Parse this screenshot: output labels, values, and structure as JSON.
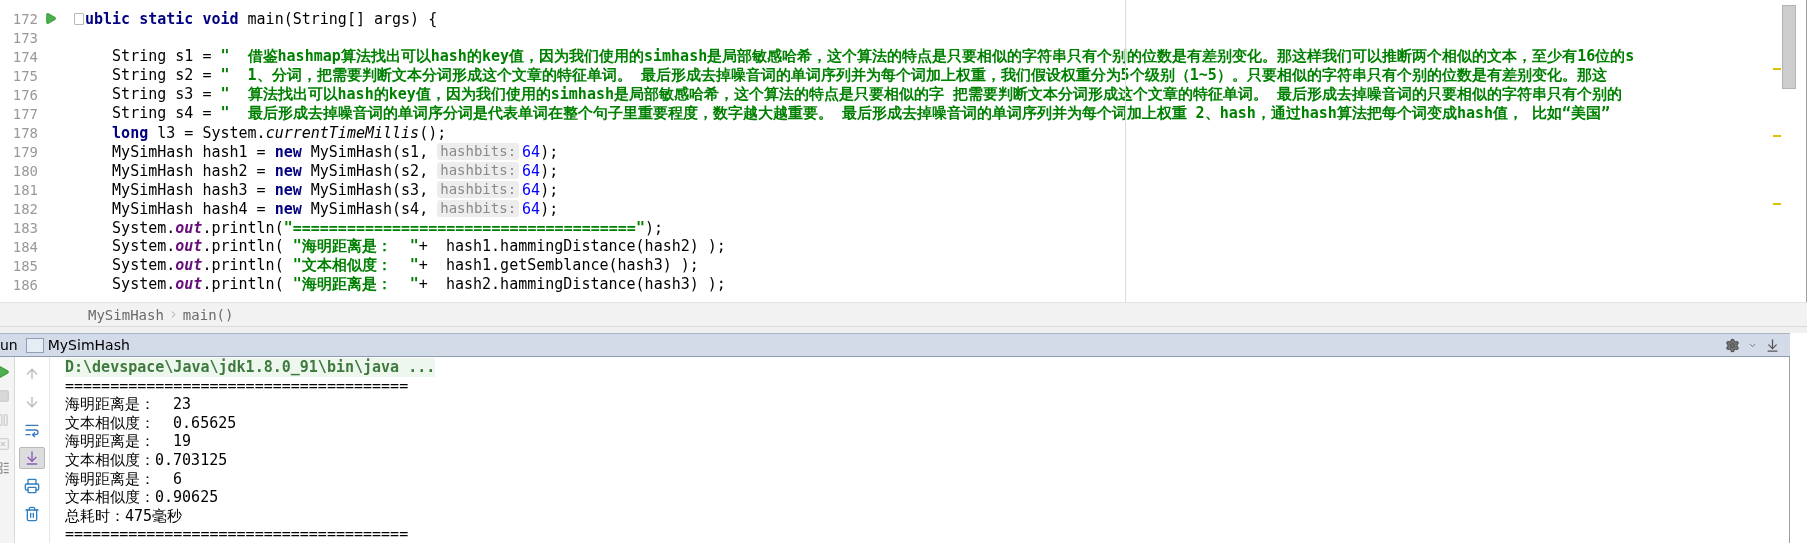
{
  "editor": {
    "lines": [
      {
        "number": "172",
        "run_marker": true,
        "fold_marker": true,
        "current": false,
        "segments": [
          {
            "kind": "keyword",
            "text": "ublic static void"
          },
          {
            "kind": "plain",
            "text": " main(String[] args) {"
          }
        ]
      },
      {
        "number": "173",
        "run_marker": false,
        "fold_marker": false,
        "current": false
      },
      {
        "number": "174",
        "run_marker": false,
        "fold_marker": false,
        "current": false,
        "segments": [
          {
            "kind": "plain",
            "text": "   String s1 = "
          },
          {
            "kind": "string",
            "text": "\"  借鉴hashmap算法找出可以hash的key值，因为我们使用的simhash是局部敏感哈希，这个算法的特点是只要相似的字符串只有个别的位数是有差别变化。那这样我们可以推断两个相似的文本，至少有16位的s"
          }
        ]
      },
      {
        "number": "175",
        "run_marker": false,
        "fold_marker": false,
        "current": false,
        "segments": [
          {
            "kind": "plain",
            "text": "   String s2 = "
          },
          {
            "kind": "string",
            "text": "\"  1、分词，把需要判断文本分词形成这个文章的特征单词。 最后形成去掉噪音词的单词序列并为每个词加上权重，我们假设权重分为5个级别（1~5）。只要相似的字符串只有个别的位数是有差别变化。那这"
          }
        ]
      },
      {
        "number": "176",
        "run_marker": false,
        "fold_marker": false,
        "current": false,
        "segments": [
          {
            "kind": "plain",
            "text": "   String s3 = "
          },
          {
            "kind": "string",
            "text": "\"  算法找出可以hash的key值，因为我们使用的simhash是局部敏感哈希，这个算法的特点是只要相似的字 把需要判断文本分词形成这个文章的特征单词。 最后形成去掉噪音词的只要相似的字符串只有个别的"
          }
        ]
      },
      {
        "number": "177",
        "run_marker": false,
        "fold_marker": false,
        "current": false,
        "segments": [
          {
            "kind": "plain",
            "text": "   String s4 = "
          },
          {
            "kind": "string",
            "text": "\"  最后形成去掉噪音词的单词序分词是代表单词在整个句子里重要程度，数字越大越重要。 最后形成去掉噪音词的单词序列并为每个词加上权重 2、hash，通过hash算法把每个词变成hash值， 比如“美国”"
          }
        ]
      },
      {
        "number": "178",
        "run_marker": false,
        "fold_marker": false,
        "current": false,
        "segments": [
          {
            "kind": "keyword",
            "text": "   long"
          },
          {
            "kind": "plain",
            "text": " l3 = System."
          },
          {
            "kind": "static",
            "text": "currentTimeMillis"
          },
          {
            "kind": "plain",
            "text": "();"
          }
        ]
      },
      {
        "number": "179",
        "run_marker": false,
        "fold_marker": false,
        "current": false,
        "segments": [
          {
            "kind": "plain",
            "text": "   MySimHash hash1 = "
          },
          {
            "kind": "keyword",
            "text": "new"
          },
          {
            "kind": "plain",
            "text": " MySimHash(s1, "
          },
          {
            "kind": "hint",
            "text": "hashbits:"
          },
          {
            "kind": "number",
            "text": "64"
          },
          {
            "kind": "plain",
            "text": ");"
          }
        ]
      },
      {
        "number": "180",
        "run_marker": false,
        "fold_marker": false,
        "current": false,
        "segments": [
          {
            "kind": "plain",
            "text": "   MySimHash hash2 = "
          },
          {
            "kind": "keyword",
            "text": "new"
          },
          {
            "kind": "plain",
            "text": " MySimHash(s2, "
          },
          {
            "kind": "hint",
            "text": "hashbits:"
          },
          {
            "kind": "number",
            "text": "64"
          },
          {
            "kind": "plain",
            "text": ");"
          }
        ]
      },
      {
        "number": "181",
        "run_marker": false,
        "fold_marker": false,
        "current": false,
        "segments": [
          {
            "kind": "plain",
            "text": "   MySimHash hash3 = "
          },
          {
            "kind": "keyword",
            "text": "new"
          },
          {
            "kind": "plain",
            "text": " MySimHash(s3, "
          },
          {
            "kind": "hint",
            "text": "hashbits:"
          },
          {
            "kind": "number",
            "text": "64"
          },
          {
            "kind": "plain",
            "text": ");"
          }
        ]
      },
      {
        "number": "182",
        "run_marker": false,
        "fold_marker": false,
        "current": false,
        "segments": [
          {
            "kind": "plain",
            "text": "   MySimHash hash4 = "
          },
          {
            "kind": "keyword",
            "text": "new"
          },
          {
            "kind": "plain",
            "text": " MySimHash(s4, "
          },
          {
            "kind": "hint",
            "text": "hashbits:"
          },
          {
            "kind": "number",
            "text": "64"
          },
          {
            "kind": "plain",
            "text": ");"
          }
        ]
      },
      {
        "number": "183",
        "run_marker": false,
        "fold_marker": false,
        "current": false,
        "segments": [
          {
            "kind": "plain",
            "text": "   System."
          },
          {
            "kind": "field",
            "text": "out"
          },
          {
            "kind": "plain",
            "text": ".println("
          },
          {
            "kind": "string",
            "text": "\"======================================\""
          },
          {
            "kind": "plain",
            "text": ");"
          }
        ]
      },
      {
        "number": "184",
        "run_marker": false,
        "fold_marker": false,
        "current": false,
        "segments": [
          {
            "kind": "plain",
            "text": "   System."
          },
          {
            "kind": "field",
            "text": "out"
          },
          {
            "kind": "plain",
            "text": ".println( "
          },
          {
            "kind": "string",
            "text": "\"海明距离是：  \""
          },
          {
            "kind": "plain",
            "text": "+  hash1.hammingDistance(hash2) );"
          }
        ]
      },
      {
        "number": "185",
        "run_marker": false,
        "fold_marker": false,
        "current": false,
        "segments": [
          {
            "kind": "plain",
            "text": "   System."
          },
          {
            "kind": "field",
            "text": "out"
          },
          {
            "kind": "plain",
            "text": ".println( "
          },
          {
            "kind": "string",
            "text": "\"文本相似度：  \""
          },
          {
            "kind": "plain",
            "text": "+  hash1.getSemblance(hash3) );"
          }
        ]
      },
      {
        "number": "186",
        "run_marker": false,
        "fold_marker": false,
        "current": false,
        "segments": [
          {
            "kind": "plain",
            "text": "   System."
          },
          {
            "kind": "field",
            "text": "out"
          },
          {
            "kind": "plain",
            "text": ".println( "
          },
          {
            "kind": "string",
            "text": "\"海明距离是：  \""
          },
          {
            "kind": "plain",
            "text": "+  hash2.hammingDistance(hash3) );"
          }
        ]
      }
    ]
  },
  "breadcrumb": [
    "MySimHash",
    "main()"
  ],
  "run_panel": {
    "tab_label": "un",
    "config_name": "MySimHash",
    "console": [
      {
        "kind": "command",
        "text": "D:\\devspace\\Java\\jdk1.8.0_91\\bin\\java ..."
      },
      {
        "kind": "output",
        "text": "======================================"
      },
      {
        "kind": "output",
        "text": "海明距离是：  23"
      },
      {
        "kind": "output",
        "text": "文本相似度：  0.65625"
      },
      {
        "kind": "output",
        "text": "海明距离是：  19"
      },
      {
        "kind": "output",
        "text": "文本相似度：0.703125"
      },
      {
        "kind": "output",
        "text": "海明距离是：  6"
      },
      {
        "kind": "output",
        "text": "文本相似度：0.90625"
      },
      {
        "kind": "output",
        "text": "总耗时：475毫秒"
      },
      {
        "kind": "output",
        "text": "======================================"
      }
    ]
  }
}
